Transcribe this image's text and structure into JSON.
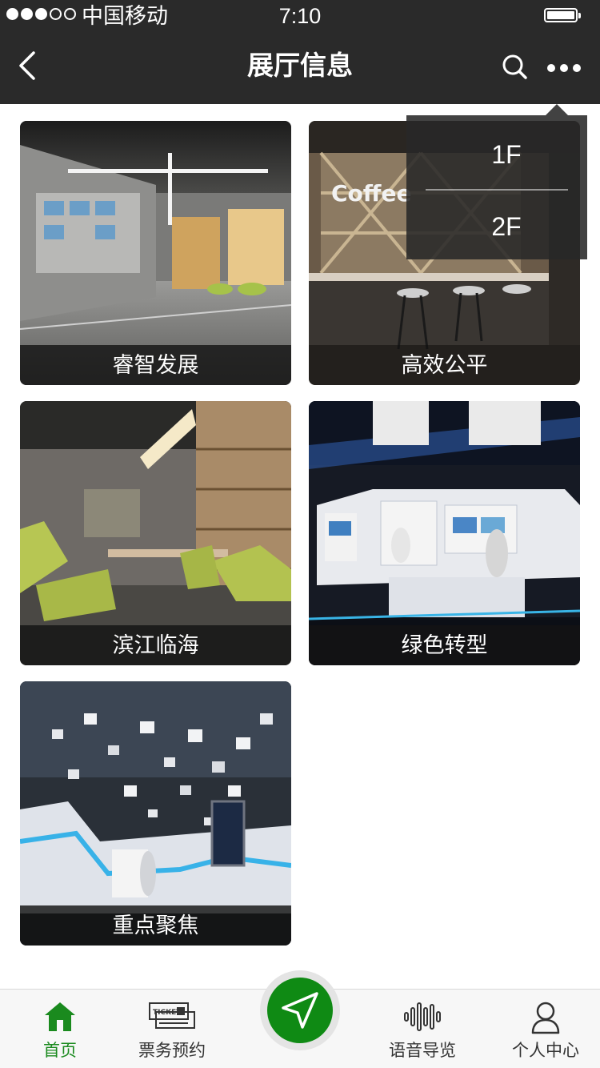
{
  "status_bar": {
    "carrier": "中国移动",
    "time": "7:10",
    "signal_strength": 3,
    "signal_max": 5
  },
  "nav": {
    "title": "展厅信息",
    "back_icon": "back-arrow-icon",
    "search_icon": "search-icon",
    "more_icon": "more-dots-icon"
  },
  "floor_menu": {
    "items": [
      "1F",
      "2F"
    ]
  },
  "halls": [
    {
      "name": "睿智发展"
    },
    {
      "name": "高效公平"
    },
    {
      "name": "滨江临海"
    },
    {
      "name": "绿色转型"
    },
    {
      "name": "重点聚焦"
    }
  ],
  "tabbar": {
    "items": [
      {
        "label": "首页",
        "icon": "home-icon",
        "active": true
      },
      {
        "label": "票务预约",
        "icon": "ticket-icon",
        "active": false
      },
      {
        "label": "",
        "icon": "navigate-arrow-icon",
        "active": false
      },
      {
        "label": "语音导览",
        "icon": "audio-wave-icon",
        "active": false
      },
      {
        "label": "个人中心",
        "icon": "user-icon",
        "active": false
      }
    ]
  },
  "colors": {
    "header_bg": "#2a2a2a",
    "accent_green": "#1a8a1e",
    "center_button_green": "#0f8a14"
  }
}
